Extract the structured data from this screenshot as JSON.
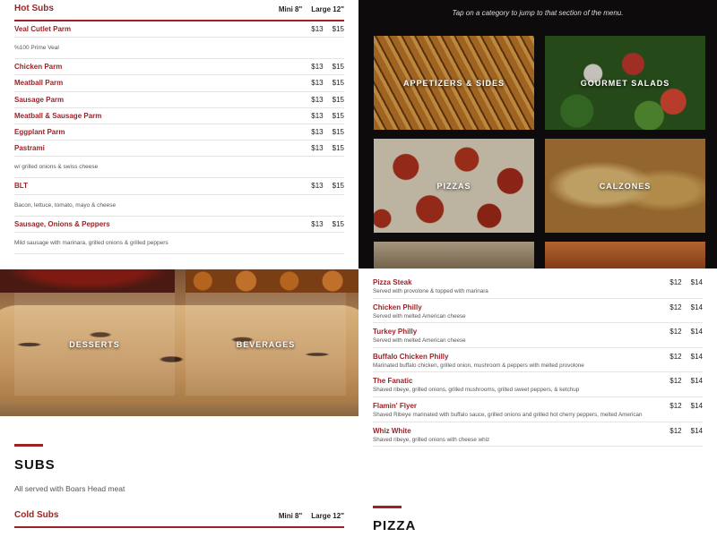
{
  "hot_subs": {
    "title": "Hot Subs",
    "size_labels": [
      "Mini 8\"",
      "Large 12\""
    ],
    "items": [
      {
        "name": "Veal Cutlet Parm",
        "prices": [
          "$13",
          "$15"
        ]
      },
      {
        "desc": "%100 Prime Veal"
      },
      {
        "name": "Chicken Parm",
        "prices": [
          "$13",
          "$15"
        ]
      },
      {
        "name": "Meatball Parm",
        "prices": [
          "$13",
          "$15"
        ]
      },
      {
        "name": "Sausage Parm",
        "prices": [
          "$13",
          "$15"
        ]
      },
      {
        "name": "Meatball & Sausage Parm",
        "prices": [
          "$13",
          "$15"
        ]
      },
      {
        "name": "Eggplant Parm",
        "prices": [
          "$13",
          "$15"
        ]
      },
      {
        "name": "Pastrami",
        "prices": [
          "$13",
          "$15"
        ]
      },
      {
        "desc": "w/ grilled onions & swiss cheese"
      },
      {
        "name": "BLT",
        "prices": [
          "$13",
          "$15"
        ]
      },
      {
        "desc": "Bacon, lettuce, tomato, mayo & cheese"
      },
      {
        "name": "Sausage, Onions & Peppers",
        "prices": [
          "$13",
          "$15"
        ]
      },
      {
        "desc": "Mild sausage with marinara, grilled onions & grilled peppers"
      }
    ]
  },
  "categories": {
    "hint": "Tap on a category to jump to that section of the menu.",
    "tiles": [
      {
        "label": "APPETIZERS & SIDES"
      },
      {
        "label": "GOURMET SALADS"
      },
      {
        "label": "PIZZAS"
      },
      {
        "label": "CALZONES"
      },
      {
        "label": ""
      },
      {
        "label": ""
      },
      {
        "label": "DESSERTS"
      },
      {
        "label": "BEVERAGES"
      }
    ]
  },
  "philly": {
    "items": [
      {
        "name": "Pizza Steak",
        "desc": "Served with provolone & topped with marinara",
        "prices": [
          "$12",
          "$14"
        ]
      },
      {
        "name": "Chicken Philly",
        "desc": "Served with melted American cheese",
        "prices": [
          "$12",
          "$14"
        ]
      },
      {
        "name": "Turkey Philly",
        "desc": "Served with melted American cheese",
        "prices": [
          "$12",
          "$14"
        ]
      },
      {
        "name": "Buffalo Chicken Philly",
        "desc": "Marinated buffalo chicken, grilled onion, mushroom & peppers with melted provolone",
        "prices": [
          "$12",
          "$14"
        ]
      },
      {
        "name": "The Fanatic",
        "desc": "Shaved ribeye, grilled onions, grilled mushrooms, grilled sweet peppers, & ketchup",
        "prices": [
          "$12",
          "$14"
        ]
      },
      {
        "name": "Flamin' Flyer",
        "desc": "Shaved Ribeye marinated with buffalo sauce, grilled onions and grilled hot cherry peppers, melted American",
        "prices": [
          "$12",
          "$14"
        ]
      },
      {
        "name": "Whiz White",
        "desc": "Shaved ribeye, grilled onions with cheese whiz",
        "prices": [
          "$12",
          "$14"
        ]
      }
    ]
  },
  "subs_section": {
    "title": "SUBS",
    "subtitle": "All served with Boars Head meat"
  },
  "cold_subs": {
    "title": "Cold Subs",
    "size_labels": [
      "Mini 8\"",
      "Large 12\""
    ]
  },
  "pizza_section": {
    "title": "PIZZA"
  },
  "colors": {
    "accent": "#9b2328",
    "dark_panel": "#0d0b0b"
  }
}
